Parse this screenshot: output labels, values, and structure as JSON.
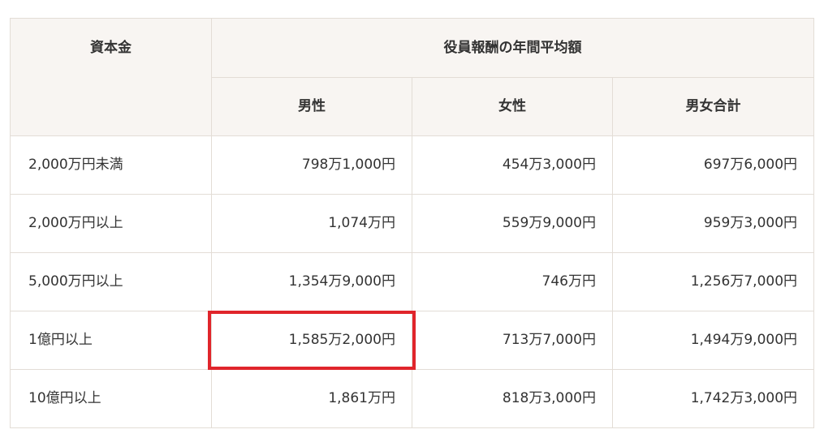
{
  "table": {
    "header": {
      "capital_label": "資本金",
      "group_label": "役員報酬の年間平均額",
      "sub_columns": [
        "男性",
        "女性",
        "男女合計"
      ]
    },
    "rows": [
      {
        "capital": "2,000万円未満",
        "male": "798万1,000円",
        "female": "454万3,000円",
        "total": "697万6,000円"
      },
      {
        "capital": "2,000万円以上",
        "male": "1,074万円",
        "female": "559万9,000円",
        "total": "959万3,000円"
      },
      {
        "capital": "5,000万円以上",
        "male": "1,354万9,000円",
        "female": "746万円",
        "total": "1,256万7,000円"
      },
      {
        "capital": "1億円以上",
        "male": "1,585万2,000円",
        "female": "713万7,000円",
        "total": "1,494万9,000円"
      },
      {
        "capital": "10億円以上",
        "male": "1,861万円",
        "female": "818万3,000円",
        "total": "1,742万3,000円"
      }
    ]
  },
  "highlight": {
    "row_index": 3,
    "column": "male",
    "color": "#e0252b"
  },
  "colors": {
    "header_bg": "#f8f5f2",
    "border": "#e3ddd6",
    "text": "#333333"
  }
}
